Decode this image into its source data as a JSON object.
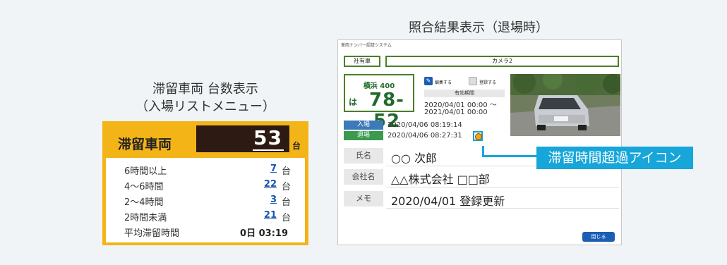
{
  "captions": {
    "left_line1": "滞留車両 台数表示",
    "left_line2": "（入場リストメニュー）",
    "right": "照合結果表示（退場時）"
  },
  "left_panel": {
    "title": "滞留車両",
    "count": "53",
    "count_unit": "台",
    "rows": [
      {
        "label": "6時間以上",
        "value": "7",
        "unit": "台"
      },
      {
        "label": "4～6時間",
        "value": "22",
        "unit": "台"
      },
      {
        "label": "2～4時間",
        "value": "3",
        "unit": "台"
      },
      {
        "label": "2時間未満",
        "value": "21",
        "unit": "台"
      }
    ],
    "average": {
      "label": "平均滞留時間",
      "value": "0日 03:19"
    }
  },
  "window": {
    "title": "車両ナンバー認証システム",
    "tab_owned": "社有車",
    "tab_camera": "カメラ2",
    "plate": {
      "top": "横浜  400",
      "kana": "は",
      "number": "78-52"
    },
    "edit_label": "編集する",
    "register_label": "登録する",
    "validity_header": "有効期間",
    "validity_from": "2020/04/01 00:00 ～",
    "validity_to": "2021/04/01 00:00",
    "entry_label": "入場",
    "exit_label": "退場",
    "entry_time": "2020/04/06 08:19:14",
    "exit_time": "2020/04/06 08:27:31",
    "name_label": "氏名",
    "name_value": "○○  次郎",
    "company_label": "会社名",
    "company_value": "△△株式会社  □□部",
    "memo_label": "メモ",
    "memo_value": "2020/04/01 登録更新",
    "close_label": "閉じる"
  },
  "callout": "滞留時間超過アイコン",
  "colors": {
    "panel_accent": "#f3b418",
    "plate_green": "#1f6a2a",
    "callout_blue": "#16a6d9",
    "entry_blue": "#3d7ab8",
    "exit_green": "#3b9a4d"
  }
}
